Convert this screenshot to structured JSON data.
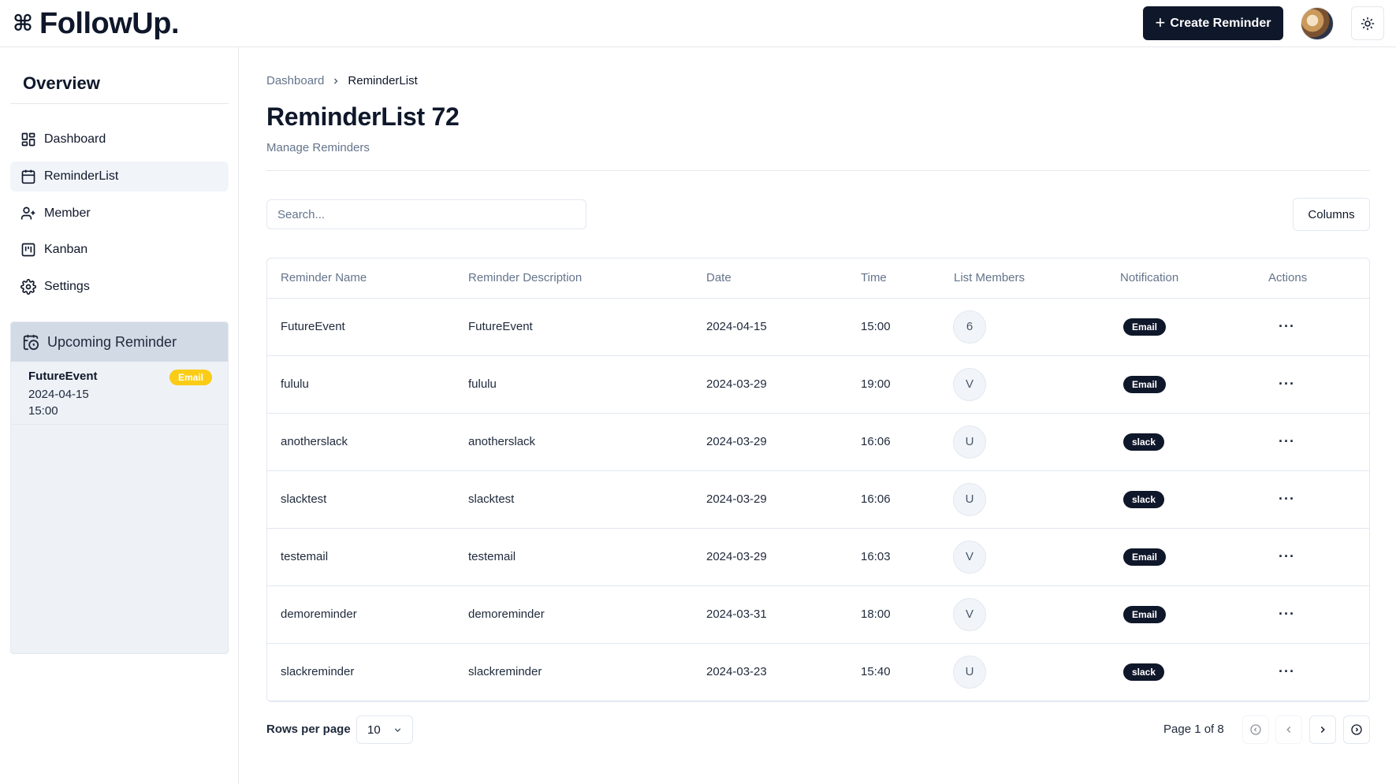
{
  "header": {
    "logo_symbol": "⌘",
    "app_name": "FollowUp.",
    "create_label": "Create Reminder",
    "theme_icon": "sun-icon"
  },
  "sidebar": {
    "section_title": "Overview",
    "items": [
      {
        "label": "Dashboard",
        "icon": "dashboard-icon"
      },
      {
        "label": "ReminderList",
        "icon": "calendar-icon"
      },
      {
        "label": "Member",
        "icon": "user-plus-icon"
      },
      {
        "label": "Kanban",
        "icon": "kanban-icon"
      },
      {
        "label": "Settings",
        "icon": "gear-icon"
      }
    ],
    "upcoming": {
      "title": "Upcoming Reminder",
      "item": {
        "name": "FutureEvent",
        "date": "2024-04-15",
        "time": "15:00",
        "badge": "Email",
        "badge_color": "#facc15"
      }
    }
  },
  "breadcrumb": {
    "home": "Dashboard",
    "current": "ReminderList"
  },
  "page": {
    "title": "ReminderList 72",
    "subtitle": "Manage Reminders"
  },
  "search": {
    "placeholder": "Search...",
    "value": ""
  },
  "columns_label": "Columns",
  "table": {
    "headers": [
      "Reminder Name",
      "Reminder Description",
      "Date",
      "Time",
      "List Members",
      "Notification",
      "Actions"
    ],
    "rows": [
      {
        "name": "FutureEvent",
        "description": "FutureEvent",
        "date": "2024-04-15",
        "time": "15:00",
        "members": "6",
        "notification": "Email"
      },
      {
        "name": "fululu",
        "description": "fululu",
        "date": "2024-03-29",
        "time": "19:00",
        "members": "V",
        "notification": "Email"
      },
      {
        "name": "anotherslack",
        "description": "anotherslack",
        "date": "2024-03-29",
        "time": "16:06",
        "members": "U",
        "notification": "slack"
      },
      {
        "name": "slacktest",
        "description": "slacktest",
        "date": "2024-03-29",
        "time": "16:06",
        "members": "U",
        "notification": "slack"
      },
      {
        "name": "testemail",
        "description": "testemail",
        "date": "2024-03-29",
        "time": "16:03",
        "members": "V",
        "notification": "Email"
      },
      {
        "name": "demoreminder",
        "description": "demoreminder",
        "date": "2024-03-31",
        "time": "18:00",
        "members": "V",
        "notification": "Email"
      },
      {
        "name": "slackreminder",
        "description": "slackreminder",
        "date": "2024-03-23",
        "time": "15:40",
        "members": "U",
        "notification": "slack"
      }
    ],
    "actions_symbol": "···"
  },
  "pagination": {
    "rows_label": "Rows per page",
    "rows_value": "10",
    "page_info": "Page 1 of 8"
  },
  "colors": {
    "primary": "#0f172a",
    "muted": "#64748b",
    "accent_yellow": "#facc15",
    "sidebar_panel": "#eef2f7"
  }
}
